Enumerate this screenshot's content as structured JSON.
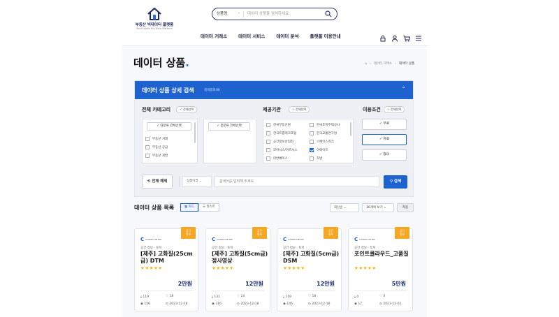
{
  "header": {
    "logo_title": "부동산 빅데이터 플랫폼",
    "logo_subtitle": "Real Estate Big Data Platform",
    "search_category": "상품명",
    "search_placeholder": "데이터 상품을 검색하세요.",
    "nav": [
      "데이터 거래소",
      "데이터 서비스",
      "데이터 분석",
      "플랫폼 이용안내"
    ]
  },
  "page": {
    "title": "데이터 상품",
    "breadcrumb": [
      "데이터 거래소",
      "데이터 상품"
    ]
  },
  "filter": {
    "title": "데이터 상품 상세 검색",
    "subtitle": "검색결과(8)",
    "category_label": "전체 카테고리",
    "category_all_btn": "전체선택",
    "major_all": "대분류 전체선택",
    "minor_all": "중분류 전체선택",
    "major_items": [
      "부동산 거래",
      "부동산 공급",
      "부동산 개발"
    ],
    "provider_label": "제공기관",
    "provider_all_btn": "전체선택",
    "providers": [
      {
        "name": "한국부동산원",
        "checked": false
      },
      {
        "name": "한국토지주택공사",
        "checked": false
      },
      {
        "name": "한국프롭테크포럼",
        "checked": false
      },
      {
        "name": "한국교통연구원",
        "checked": false
      },
      {
        "name": "공간정보산업진...",
        "checked": false
      },
      {
        "name": "스페이스워크",
        "checked": false
      },
      {
        "name": "모아시스/이즈시스",
        "checked": false
      },
      {
        "name": "이에이트",
        "checked": true
      },
      {
        "name": "어반베이스",
        "checked": false
      },
      {
        "name": "직방",
        "checked": false
      }
    ],
    "terms_label": "이용조건",
    "terms_all_btn": "전체선택",
    "terms": [
      {
        "name": "무료",
        "selected": false
      },
      {
        "name": "유료",
        "selected": true
      },
      {
        "name": "협의",
        "selected": false
      }
    ],
    "reset_label": "전체 해제",
    "query_select": "상품이름",
    "query_placeholder": "검색어를 입력해 주세요.",
    "search_btn": "검색"
  },
  "list": {
    "title": "데이터 상품 목록",
    "view_card": "카드",
    "view_list": "리스트",
    "sort": "최신순",
    "per_page": "16개씩 보기",
    "apply": "적용"
  },
  "cards": [
    {
      "badge_l1": "공간",
      "badge_l2": "정보",
      "provider": "COSMO DB INC",
      "category": "공간 정보 · 토지",
      "name": "[제주] 고화질(25cm급) DTM",
      "stars": "★★★★★",
      "price": "2만원",
      "downloads": "119",
      "likes": "18",
      "views": "156",
      "date": "2023-12-18"
    },
    {
      "badge_l1": "공간",
      "badge_l2": "정보",
      "provider": "COSMO DB INC",
      "category": "공간 정보 · 토지",
      "name": "[제주] 고화질(5cm급) 정사영상",
      "stars": "★★★★★",
      "price": "12만원",
      "downloads": "131",
      "likes": "14",
      "views": "316",
      "date": "2023-12-18"
    },
    {
      "badge_l1": "공간",
      "badge_l2": "정보",
      "provider": "COSMO DB INC",
      "category": "공간 정보 · 토지",
      "name": "[제주] 고화질(5cm급) DSM",
      "stars": "★★★★★",
      "price": "12만원",
      "downloads": "119",
      "likes": "18",
      "views": "146",
      "date": "2023-12-18"
    },
    {
      "badge_l1": "공간",
      "badge_l2": "정보",
      "provider": "COSMO DB INC",
      "category": "공간 정보 · 토지",
      "name": "포인트클라우드_고품질",
      "stars": "★★★★★",
      "price": "5만원",
      "downloads": "0",
      "likes": "0",
      "views": "17",
      "date": "2023-12-01"
    }
  ],
  "colors": {
    "primary": "#1e62d0",
    "navy": "#1c2b5a",
    "badge": "#f5a623",
    "star": "#f5b301"
  }
}
